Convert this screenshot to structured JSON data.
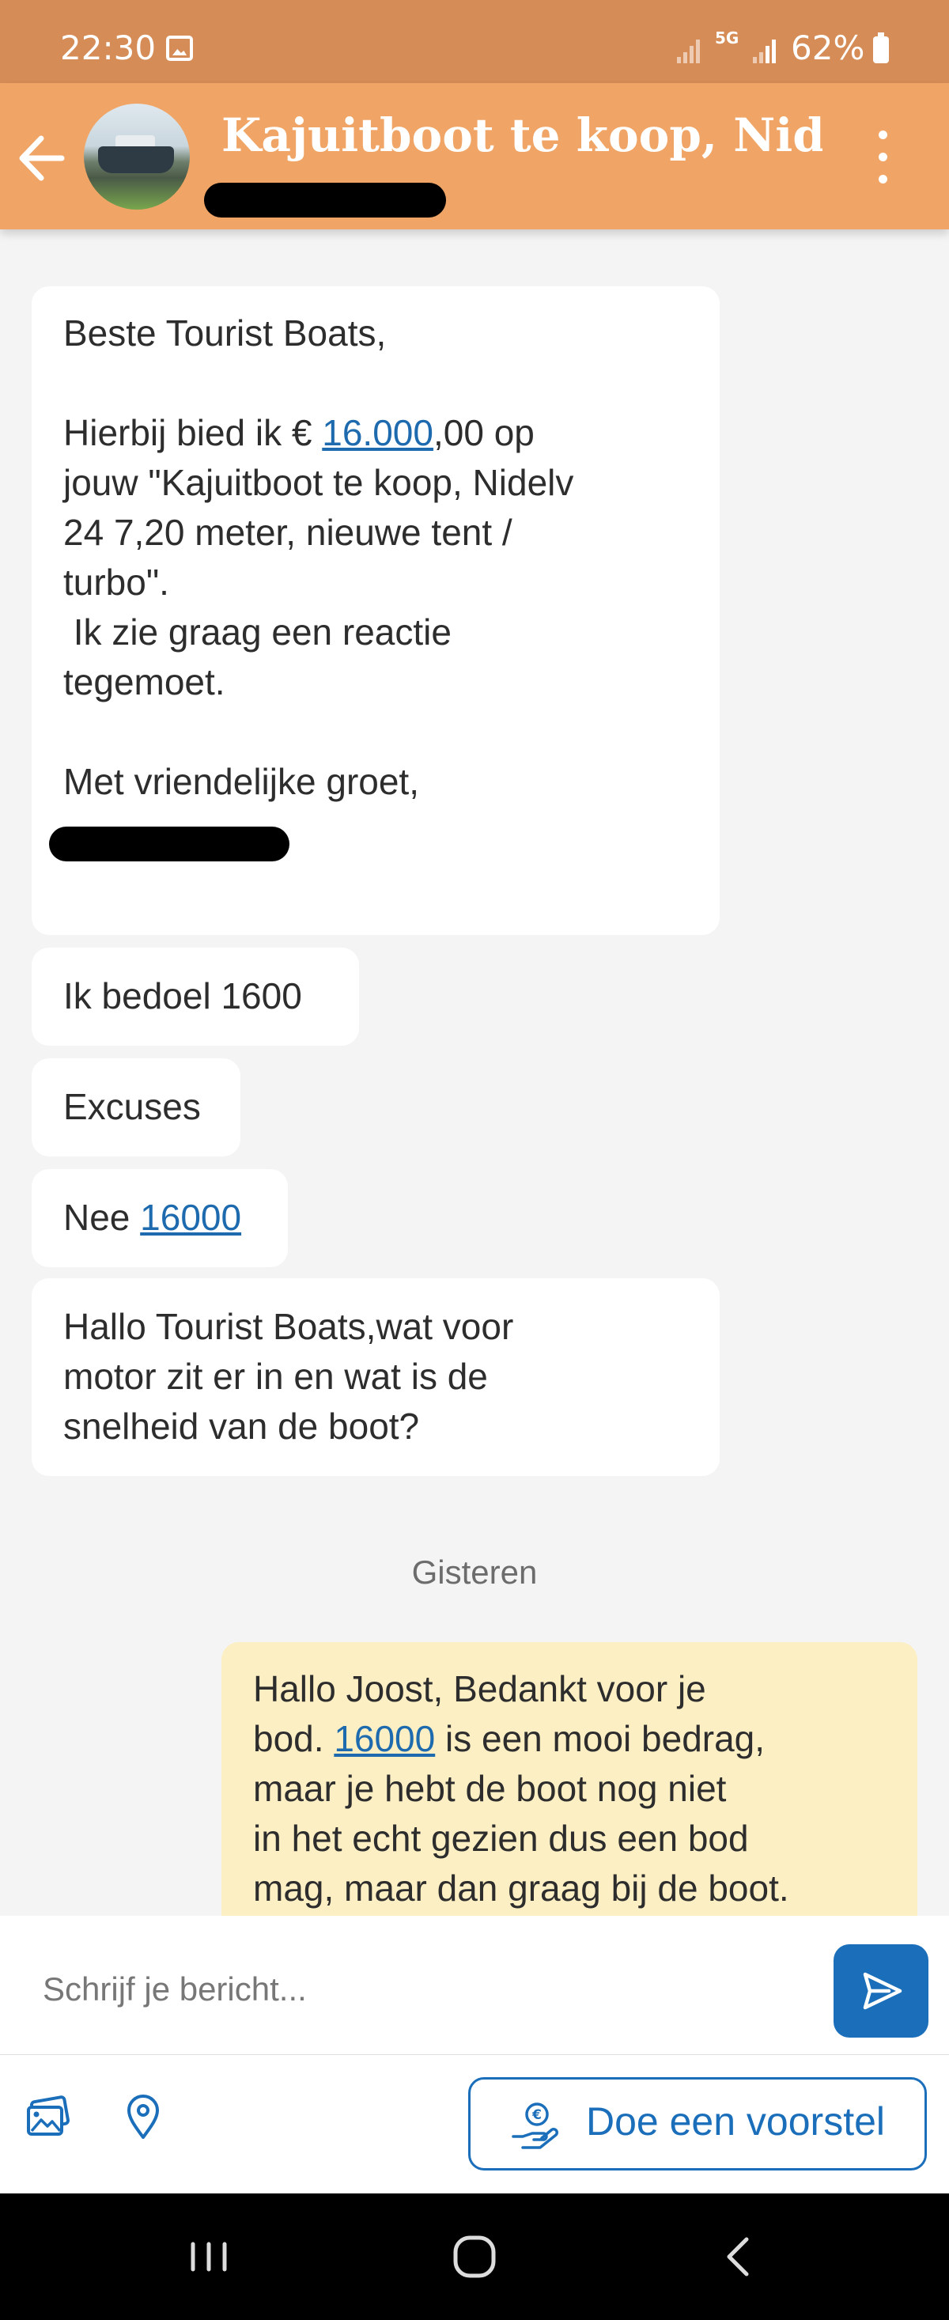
{
  "status_bar": {
    "time": "22:30",
    "network": "5G",
    "battery": "62%"
  },
  "header": {
    "title": "Kajuitboot te koop, Nid...",
    "back_icon": "arrow-left-icon",
    "menu_icon": "more-vertical-icon",
    "bg_color": "#f0a566"
  },
  "messages": [
    {
      "from": "other",
      "lines": [
        "Beste Tourist Boats,",
        "",
        "Hierbij bied ik € ",
        "jouw \"Kajuitboot te koop, Nidelv",
        "24 7,20 meter, nieuwe tent /",
        "turbo\".",
        " Ik zie graag een reactie",
        "tegemoet.",
        "",
        "Met vriendelijke groet,"
      ],
      "link_text": "16.000",
      "after_link": ",00 op"
    },
    {
      "from": "other",
      "text": "Ik bedoel 1600"
    },
    {
      "from": "other",
      "text": "Excuses"
    },
    {
      "from": "other",
      "prefix": "Nee ",
      "link_text": "16000"
    },
    {
      "from": "other",
      "lines": [
        "Hallo Tourist Boats,wat voor",
        "motor zit er in en wat is de",
        "snelheid van de boot?"
      ]
    },
    {
      "from": "me",
      "lines": [
        "Hallo Joost, Bedankt voor je",
        "bod. ",
        "maar je hebt de boot nog niet",
        "in het echt gezien dus een bod",
        "mag, maar dan graag bij de boot."
      ],
      "link_text": "16000",
      "after_link": " is een mooi bedrag,"
    }
  ],
  "date_separator": "Gisteren",
  "composer": {
    "placeholder": "Schrijf je bericht...",
    "send_icon": "send-icon"
  },
  "toolbar": {
    "gallery_icon": "image-gallery-icon",
    "location_icon": "location-pin-icon",
    "offer_label": "Doe een voorstel",
    "offer_icon": "euro-hand-icon",
    "accent_color": "#1a6eba"
  }
}
